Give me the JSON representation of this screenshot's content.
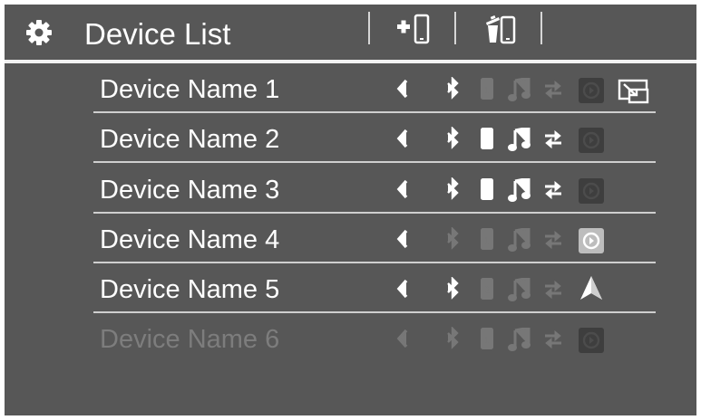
{
  "header": {
    "title": "Device List",
    "settings_icon": "gear-icon",
    "add_device_icon": "add-phone-icon",
    "delete_device_icon": "delete-phone-icon"
  },
  "devices": [
    {
      "name": "Device Name 1",
      "state": "connected",
      "slot": "1",
      "bluetooth": "active",
      "phone": "inactive",
      "audio": "inactive",
      "data": "inactive",
      "app_icon": "app-connect-icon",
      "app_state": "inactive",
      "extra_icon": "screen-mirror-icon"
    },
    {
      "name": "Device Name 2",
      "state": "connected",
      "slot": "2",
      "bluetooth": "active",
      "phone": "active",
      "audio": "active",
      "data": "active",
      "app_icon": "app-connect-icon",
      "app_state": "inactive"
    },
    {
      "name": "Device Name 3",
      "state": "connected",
      "slot": "1",
      "bluetooth": "active",
      "phone": "active",
      "audio": "active",
      "data": "active",
      "app_icon": "app-connect-icon",
      "app_state": "inactive"
    },
    {
      "name": "Device Name 4",
      "state": "connected",
      "slot": "1",
      "bluetooth": "inactive",
      "phone": "inactive",
      "audio": "inactive",
      "data": "inactive",
      "app_icon": "app-connect-icon",
      "app_state": "active"
    },
    {
      "name": "Device Name 5",
      "state": "connected",
      "slot": "2",
      "bluetooth": "active",
      "phone": "inactive",
      "audio": "inactive",
      "data": "inactive",
      "app_icon": "navigation-arrow-icon",
      "app_state": "active"
    },
    {
      "name": "Device Name 6",
      "state": "disabled",
      "slot": "1",
      "bluetooth": "inactive",
      "phone": "inactive",
      "audio": "inactive",
      "data": "inactive",
      "app_icon": "app-connect-icon",
      "app_state": "inactive"
    }
  ],
  "colors": {
    "background": "#575757",
    "text": "#ffffff",
    "dimmed": "#777777",
    "divider": "#cfcfcf"
  }
}
